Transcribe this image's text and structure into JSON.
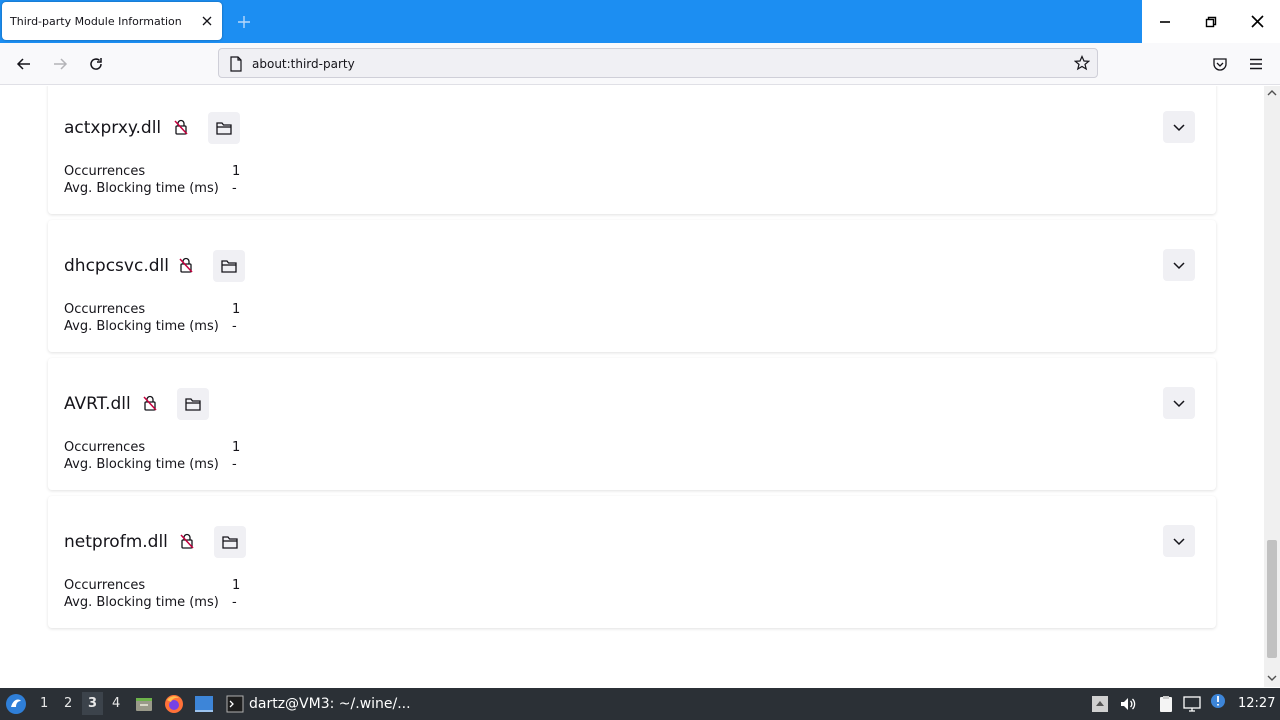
{
  "browser": {
    "tab_title": "Third-party Module Information",
    "url": "about:third-party"
  },
  "modules": [
    {
      "name": "actxprxy.dll",
      "occurrences_label": "Occurrences",
      "occurrences": "1",
      "blocking_label": "Avg. Blocking time (ms)",
      "blocking": "-"
    },
    {
      "name": "dhcpcsvc.dll",
      "occurrences_label": "Occurrences",
      "occurrences": "1",
      "blocking_label": "Avg. Blocking time (ms)",
      "blocking": "-"
    },
    {
      "name": "AVRT.dll",
      "occurrences_label": "Occurrences",
      "occurrences": "1",
      "blocking_label": "Avg. Blocking time (ms)",
      "blocking": "-"
    },
    {
      "name": "netprofm.dll",
      "occurrences_label": "Occurrences",
      "occurrences": "1",
      "blocking_label": "Avg. Blocking time (ms)",
      "blocking": "-"
    }
  ],
  "taskbar": {
    "workspaces": [
      "1",
      "2",
      "3",
      "4"
    ],
    "active_workspace": "3",
    "terminal_task": "dartz@VM3: ~/.wine/...",
    "clock": "12:27"
  },
  "colors": {
    "tab_bar": "#1c8ef2",
    "lock_icon": "#c5003e",
    "taskbar": "#2b3036"
  }
}
